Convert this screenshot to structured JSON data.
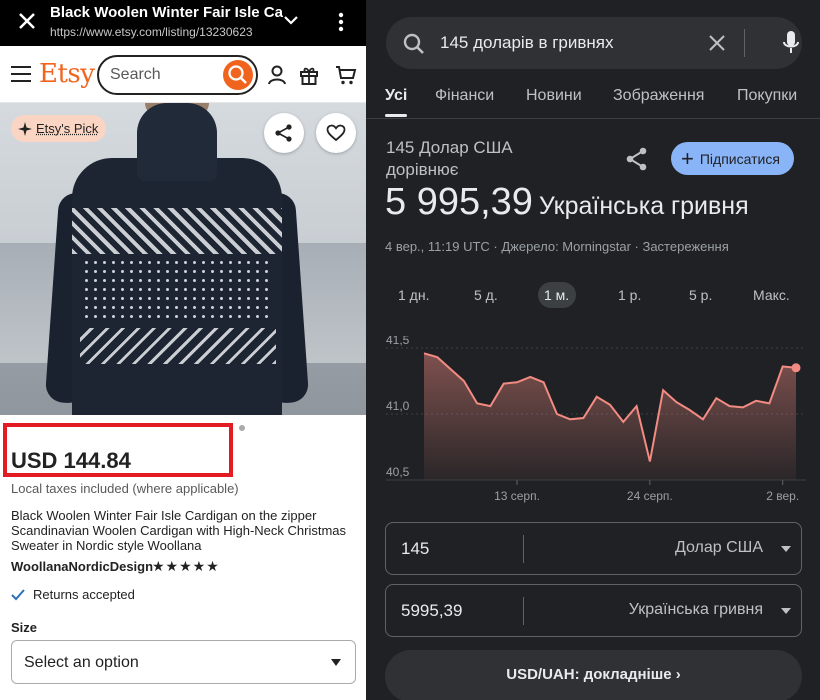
{
  "etsy": {
    "browser": {
      "title": "Black Woolen Winter Fair Isle Ca",
      "url": "https://www.etsy.com/listing/13230623",
      "close_icon": "close-icon",
      "chevron_icon": "chevron-down-icon",
      "menu_icon": "more-vert-icon"
    },
    "header": {
      "logo": "Etsy",
      "search_placeholder": "Search",
      "accent": "#f1641e"
    },
    "badge": "Etsy's Pick",
    "price": "USD 144.84",
    "highlight_color": "#e31b23",
    "taxes_note": "Local taxes included (where applicable)",
    "description": "Black Woolen Winter Fair Isle Cardigan on the zipper Scandinavian Woolen Cardigan with High-Neck Christmas Sweater in Nordic style Woollana",
    "shop_name": "WoollanaNordicDesign",
    "rating_stars": 5,
    "stars_text": "★★★★★",
    "returns": "Returns accepted",
    "size_label": "Size",
    "size_select": "Select an option"
  },
  "google": {
    "query": "145 доларів в гривнях",
    "tabs": [
      "Усі",
      "Фінанси",
      "Новини",
      "Зображення",
      "Покупки"
    ],
    "active_tab": "Усі",
    "from_text": "145 Долар США дорівнює",
    "result_amount": "5 995,39",
    "result_currency": "Українська гривня",
    "subscribe_label": "Підписатися",
    "meta": "4 вер., 11:19 UTC · Джерело: Morningstar · Застереження",
    "ranges": [
      "1 дн.",
      "5 д.",
      "1 м.",
      "1 р.",
      "5 р.",
      "Макс."
    ],
    "active_range": "1 м.",
    "input_amount": "145",
    "input_currency": "Долар США",
    "output_amount": "5995,39",
    "output_currency": "Українська гривня",
    "more_button": "USD/UAH: докладніше",
    "accent": "#8ab4f8",
    "line_color": "#f28b82"
  },
  "chart_data": {
    "type": "area",
    "title": "",
    "xlabel": "",
    "ylabel": "",
    "ylim": [
      40.5,
      41.5
    ],
    "yticks": [
      40.5,
      41.0,
      41.5
    ],
    "ytick_labels": [
      "40,5",
      "41,0",
      "41,5"
    ],
    "x_labels": [
      "13 серп.",
      "24 серп.",
      "2 вер."
    ],
    "x_label_index": [
      7,
      17,
      27
    ],
    "grid": true,
    "values": [
      41.46,
      41.43,
      41.34,
      41.25,
      41.08,
      41.06,
      41.23,
      41.24,
      41.28,
      41.24,
      41.0,
      40.96,
      40.97,
      41.13,
      41.07,
      40.94,
      41.06,
      40.64,
      41.18,
      41.09,
      41.03,
      40.96,
      41.12,
      41.06,
      41.05,
      41.1,
      41.08,
      41.36,
      41.35
    ]
  }
}
